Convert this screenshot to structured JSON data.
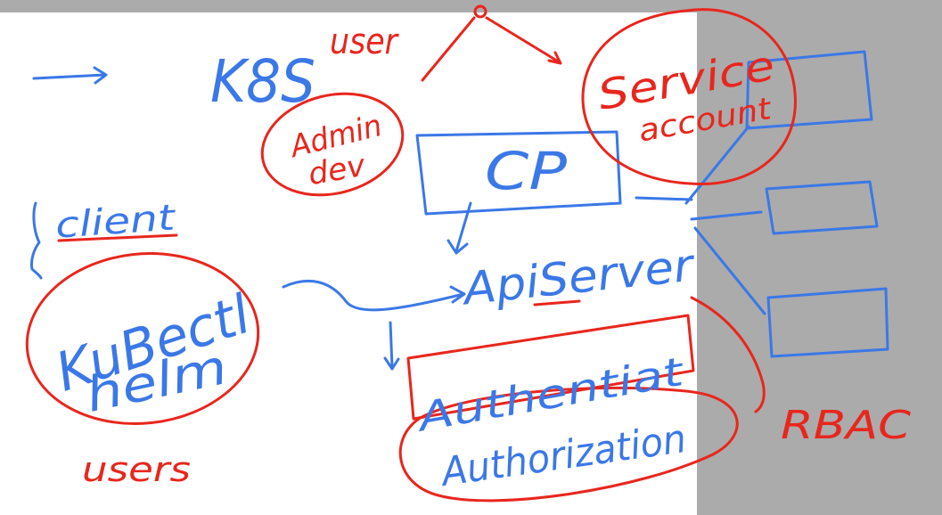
{
  "colors": {
    "blue_ink": "#3b78e7",
    "red_ink": "#e8261d",
    "canvas": "#ffffff",
    "background": "#ababab"
  },
  "labels": {
    "k8s": "K8S",
    "user": "user",
    "admin": "Admin",
    "dev": "dev",
    "service": "Service",
    "account": "account",
    "cp": "CP",
    "client": "client",
    "kubectl": "KuBectl",
    "helm": "helm",
    "users": "users",
    "apiserver": "ApiServer",
    "authentication": "Authentiat",
    "authorization": "Authorization",
    "rbac": "RBAC"
  }
}
